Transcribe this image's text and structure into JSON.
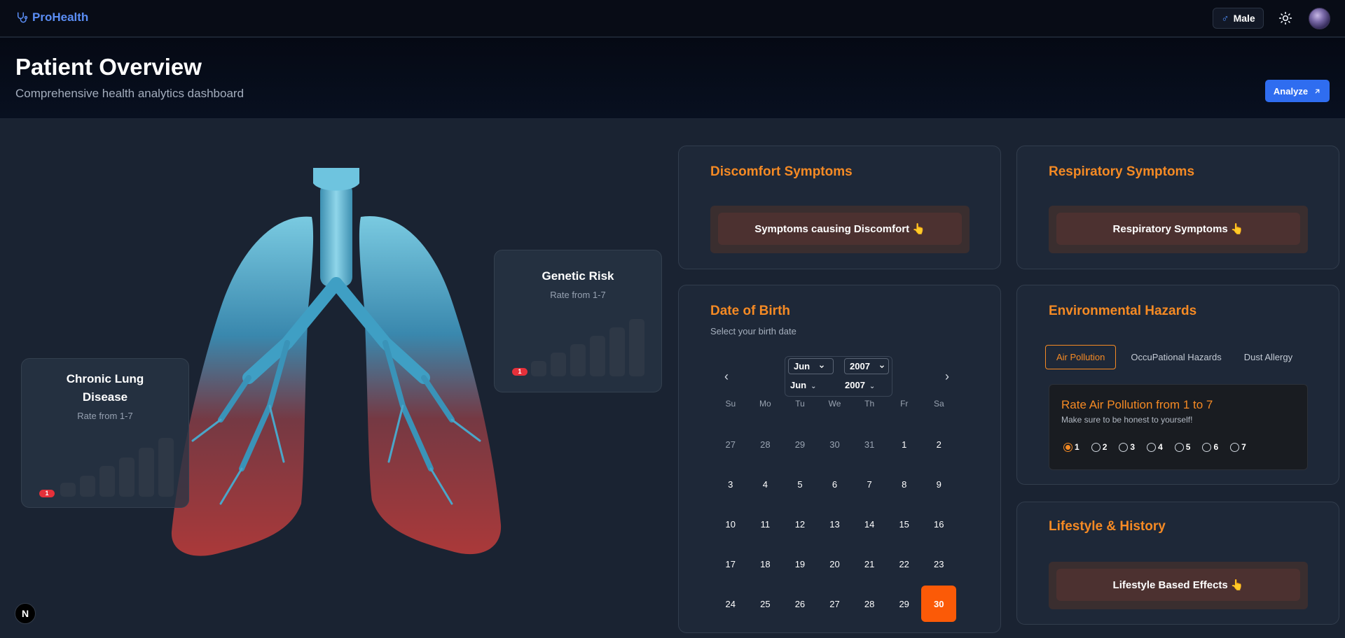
{
  "app": {
    "name": "ProHealth"
  },
  "nav": {
    "gender_label": "Male",
    "gender_symbol": "♂",
    "avatar": "user-avatar"
  },
  "header": {
    "title": "Patient Overview",
    "subtitle": "Comprehensive health analytics dashboard",
    "analyze_label": "Analyze"
  },
  "risk_cards": {
    "chronic": {
      "title": "Chronic Lung Disease",
      "subtitle": "Rate from 1-7",
      "rating": 1
    },
    "genetic": {
      "title": "Genetic Risk",
      "subtitle": "Rate from 1-7",
      "rating": 1
    }
  },
  "discomfort": {
    "title": "Discomfort Symptoms",
    "button": "Symptoms causing Discomfort",
    "button_emoji": "👆"
  },
  "respiratory": {
    "title": "Respiratory Symptoms",
    "button": "Respiratory Symptoms",
    "button_emoji": "👆"
  },
  "dob": {
    "title": "Date of Birth",
    "subtitle": "Select your birth date",
    "month_select": "Jun",
    "year_select": "2007",
    "caption_month": "Jun",
    "caption_year": "2007",
    "weekdays": [
      "Su",
      "Mo",
      "Tu",
      "We",
      "Th",
      "Fr",
      "Sa"
    ],
    "weeks": [
      [
        "27",
        "28",
        "29",
        "30",
        "31",
        "1",
        "2"
      ],
      [
        "3",
        "4",
        "5",
        "6",
        "7",
        "8",
        "9"
      ],
      [
        "10",
        "11",
        "12",
        "13",
        "14",
        "15",
        "16"
      ],
      [
        "17",
        "18",
        "19",
        "20",
        "21",
        "22",
        "23"
      ],
      [
        "24",
        "25",
        "26",
        "27",
        "28",
        "29",
        "30"
      ]
    ],
    "selected_day": "30",
    "accent": "#fb5a07"
  },
  "environment": {
    "title": "Environmental Hazards",
    "tabs": [
      "Air Pollution",
      "OccuPational Hazards",
      "Dust Allergy"
    ],
    "active_tab": "Air Pollution",
    "rate_title": "Rate Air Pollution from 1 to 7",
    "rate_subtitle": "Make sure to be honest to yourself!",
    "options": [
      "1",
      "2",
      "3",
      "4",
      "5",
      "6",
      "7"
    ],
    "selected": "1"
  },
  "lifestyle": {
    "title": "Lifestyle & History",
    "button": "Lifestyle Based Effects",
    "button_emoji": "👆"
  },
  "corner_badge": "N",
  "colors": {
    "accent_orange": "#f58a24",
    "brand_blue": "#5b8ef5",
    "analyze_blue": "#2f6df0",
    "danger": "#e5303a"
  }
}
